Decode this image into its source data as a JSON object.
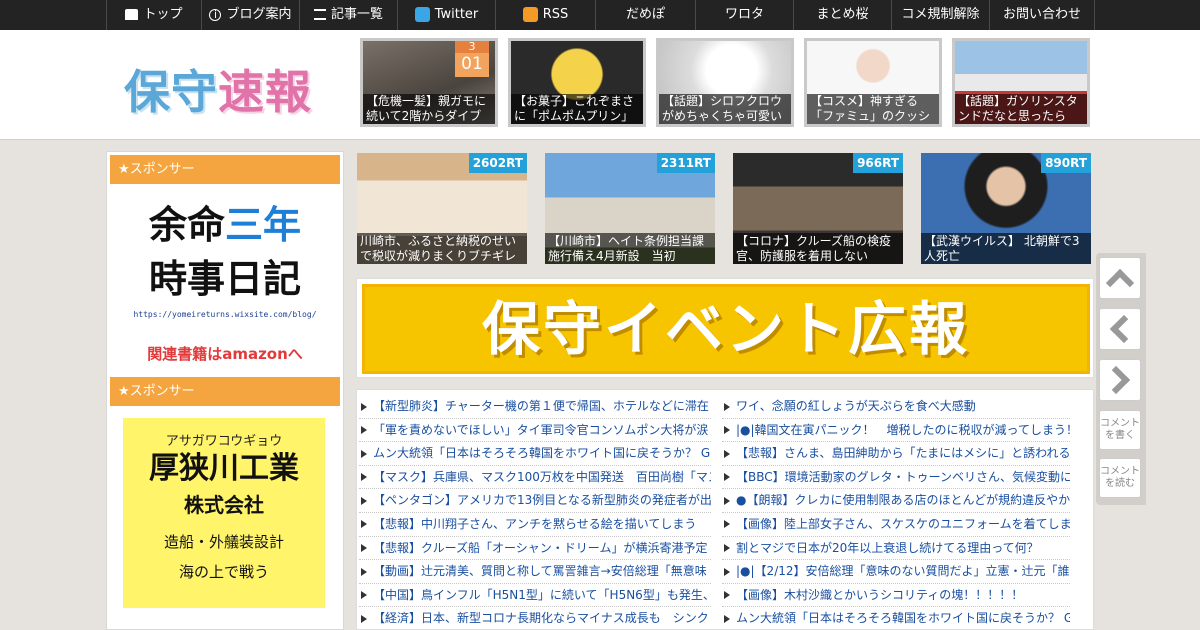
{
  "nav": {
    "items": [
      {
        "label": "トップ",
        "icon": "home-icon"
      },
      {
        "label": "ブログ案内",
        "icon": "info-icon"
      },
      {
        "label": "記事一覧",
        "icon": "list-icon"
      },
      {
        "label": "Twitter",
        "icon": "twitter-icon"
      },
      {
        "label": "RSS",
        "icon": "rss-icon"
      },
      {
        "label": "だめぽ"
      },
      {
        "label": "ワロタ"
      },
      {
        "label": "まとめ桜"
      },
      {
        "label": "コメ規制解除"
      },
      {
        "label": "お問い合わせ"
      }
    ]
  },
  "header": {
    "logo_part1": "保守",
    "logo_part2": "速報",
    "date_badge": {
      "month": "3",
      "day": "01"
    },
    "thumbs": [
      "【危機一髪】親ガモに続いて2階からダイブ",
      "【お菓子】これぞまさに「ポムポムプリン」",
      "【話題】シロフクロウがめちゃくちゃ可愛い",
      "【コスメ】神すぎる「ファミュ」のクッション",
      "【話題】ガソリンスタンドだなと思ったら"
    ]
  },
  "sidebar": {
    "sponsor_title_1": "★スポンサー",
    "ad1": {
      "line1_black": "余命",
      "line1_blue": "三年",
      "line2": "時事日記",
      "url": "https://yomeireturns.wixsite.com/blog/",
      "link": "関連書籍はamazonへ"
    },
    "sponsor_title_2": "★スポンサー",
    "ad2": {
      "kana": "アサガワコウギョウ",
      "name": "厚狭川工業",
      "corp": "株式会社",
      "service": "造船・外艤装設計",
      "extra": "海の上で戦う"
    }
  },
  "rt_posts": [
    {
      "rt": "2602RT",
      "caption": "川崎市、ふるさと納税のせいで税収が減りまくりブチギレ"
    },
    {
      "rt": "2311RT",
      "caption": "【川崎市】ヘイト条例担当課　施行備え4月新設　当初"
    },
    {
      "rt": "966RT",
      "caption": "【コロナ】クルーズ船の検疫官、防護服を着用しない"
    },
    {
      "rt": "890RT",
      "caption": "【武漢ウイルス】 北朝鮮で3人死亡"
    }
  ],
  "banner": {
    "text": "保守イベント広報"
  },
  "news": {
    "left": [
      "【新型肺炎】チャーター機の第１便で帰国、ホテルなどに滞在",
      "「軍を責めないでほしい」タイ軍司令官コンソムポン大将が涙",
      "ムン大統領「日本はそろそろ韓国をホワイト国に戻そうか？ G",
      "【マスク】兵庫県、マスク100万枚を中国発送　百田尚樹「マス",
      "【ペンタゴン】アメリカで13例目となる新型肺炎の発症者が出",
      "【悲報】中川翔子さん、アンチを黙らせる絵を描いてしまう",
      "【悲報】クルーズ船「オーシャン・ドリーム」が横浜寄港予定",
      "【動画】辻元清美、質問と称して罵詈雑言→安倍総理「無意味",
      "【中国】鳥インフル「H5N1型」に続いて「H5N6型」も発生、",
      "【経済】日本、新型コロナ長期化ならマイナス成長も　シンク"
    ],
    "right": [
      "ワイ、念願の紅しょうが天ぷらを食べ大感動",
      "|●|韓国文在寅パニック！　増税したのに税収が減ってしまう！",
      "【悲報】さんま、島田紳助から「たまにはメシに」と誘われる",
      "【BBC】環境活動家のグレタ・トゥーンベリさん、気候変動に",
      "●【朗報】クレカに使用制限ある店のほとんどが規約違反やか",
      "【画像】陸上部女子さん、スケスケのユニフォームを着てしま",
      "割とマジで日本が20年以上衰退し続けてる理由って何？",
      "|●|【2/12】安倍総理「意味のない質問だよ」立憲・辻元「誰が",
      "【画像】木村沙織とかいうシコリティの塊！！！！！",
      "ムン大統領「日本はそろそろ韓国をホワイト国に戻そうか？ G"
    ]
  },
  "side_buttons": {
    "write_comment": "コメントを書く",
    "read_comment": "コメントを読む"
  },
  "colors": {
    "nav_bg": "#232323",
    "sponsor_orange": "#f4a540",
    "rt_badge": "#24a1d8",
    "banner_yellow": "#f7c400",
    "link_blue": "#1a4fa0"
  }
}
